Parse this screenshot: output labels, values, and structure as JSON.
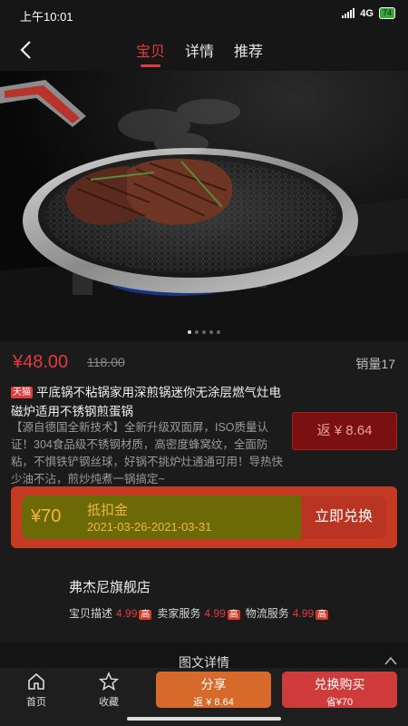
{
  "status": {
    "time": "上午10:01",
    "network": "4G",
    "battery": "74"
  },
  "nav": {
    "tabs": [
      "宝贝",
      "详情",
      "推荐"
    ],
    "active_tab": 0
  },
  "carousel": {
    "total": 5,
    "active": 0
  },
  "product": {
    "price": "¥48.00",
    "original_price": "118.00",
    "sales": "销量17",
    "tag": "天猫",
    "title": "平底锅不粘锅家用深煎锅迷你无涂层燃气灶电磁炉适用不锈钢煎蛋锅",
    "description": "【源自德国全新技术】全新升级双面屏，ISO质量认证！304食品级不锈钢材质，高密度蜂窝纹，全面防粘，不惧铁铲钢丝球，好锅不挑炉灶通通可用！导热快少油不沾，煎炒炖煮一锅搞定~",
    "rebate": "返 ¥ 8.64"
  },
  "coupon": {
    "amount": "¥70",
    "title": "抵扣金",
    "date": "2021-03-26-2021-03-31",
    "button": "立即兑换"
  },
  "shop": {
    "name": "弗杰尼旗舰店",
    "scores": [
      {
        "label": "宝贝描述",
        "value": "4.99",
        "level": "高"
      },
      {
        "label": "卖家服务",
        "value": "4.99",
        "level": "高"
      },
      {
        "label": "物流服务",
        "value": "4.99",
        "level": "高"
      }
    ]
  },
  "detail": {
    "title": "图文详情"
  },
  "bottom": {
    "home_label": "首页",
    "favorite_label": "收藏",
    "share_label": "分享",
    "share_sub": "返 ¥ 8.64",
    "buy_label": "兑换购买",
    "buy_sub": "省¥70"
  },
  "colors": {
    "accent": "#e23b3b",
    "background": "#1b1b1b",
    "share": "#d66a2b",
    "buy": "#cf3b3b"
  }
}
